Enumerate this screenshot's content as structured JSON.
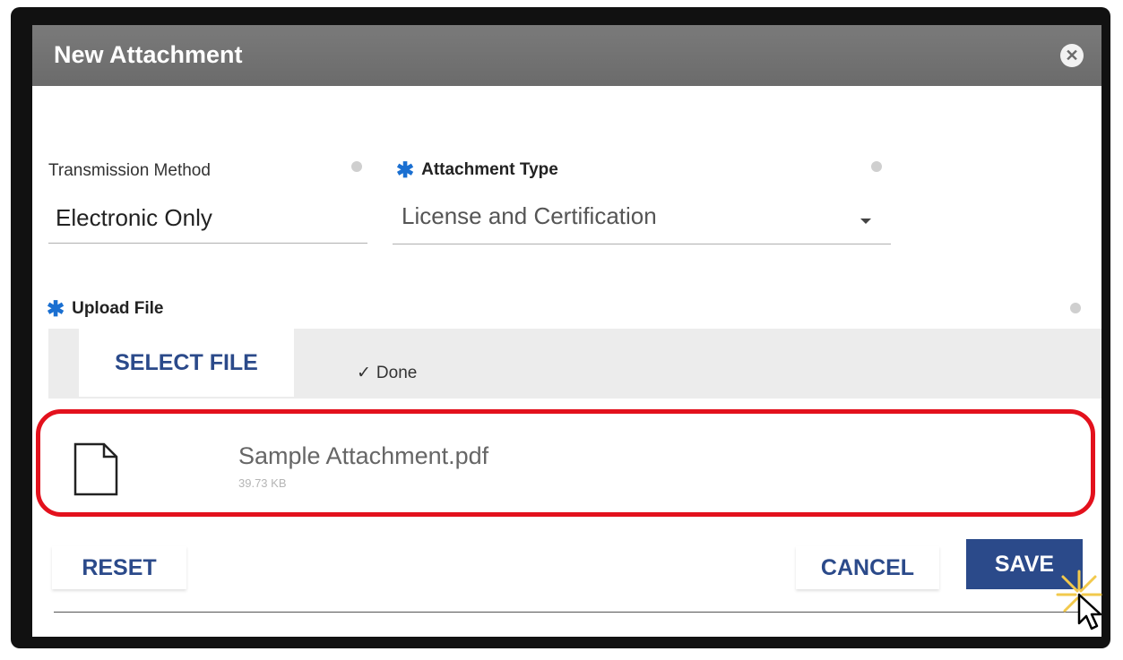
{
  "dialog": {
    "title": "New Attachment",
    "close_icon": "close-circle-icon"
  },
  "fields": {
    "transmission_method": {
      "label": "Transmission Method",
      "value": "Electronic Only"
    },
    "attachment_type": {
      "label": "Attachment Type",
      "value": "License and Certification",
      "required": true
    },
    "upload_file": {
      "label": "Upload File",
      "required": true
    }
  },
  "upload": {
    "select_file_label": "SELECT FILE",
    "status": "Done",
    "file": {
      "name": "Sample Attachment.pdf",
      "size": "39.73 KB"
    }
  },
  "actions": {
    "reset": "RESET",
    "cancel": "CANCEL",
    "save": "SAVE"
  },
  "colors": {
    "titlebar": "#6b6b6b",
    "primary": "#2b4a8a",
    "required": "#1a6fd1",
    "highlight": "#e3111d"
  }
}
